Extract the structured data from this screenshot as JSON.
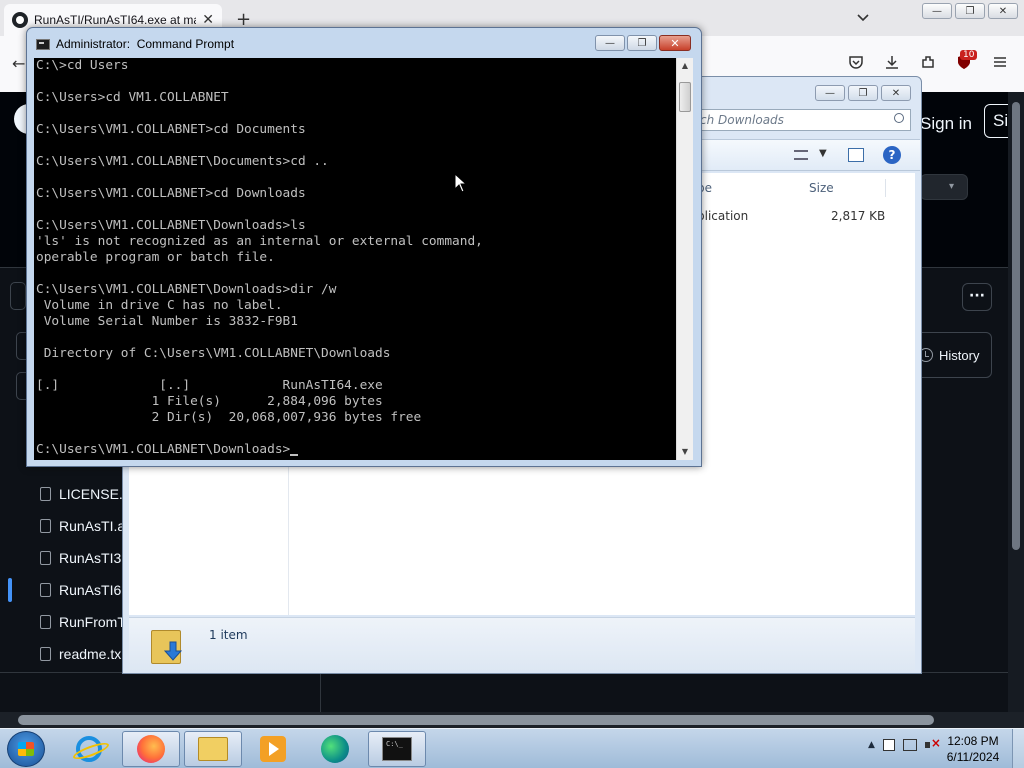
{
  "browser": {
    "tab_title": "RunAsTI/RunAsTI64.exe at ma",
    "tab_close": "✕",
    "new_tab": "+",
    "badge_count": "10",
    "win_min": "—",
    "win_restore": "❐",
    "win_close": "✕"
  },
  "github": {
    "sign_in": "Sign in",
    "sign_up": "Si",
    "more": "···",
    "history_label": "History",
    "files": [
      {
        "name": "LICENSE.r"
      },
      {
        "name": "RunAsTI.a"
      },
      {
        "name": "RunAsTI3"
      },
      {
        "name": "RunAsTI6"
      },
      {
        "name": "RunFromT"
      },
      {
        "name": "readme.tx"
      }
    ]
  },
  "explorer": {
    "search_placeholder": "ch Downloads",
    "columns": [
      "pe",
      "Size"
    ],
    "rows": [
      {
        "type": "plication",
        "size": "2,817 KB"
      }
    ],
    "status": "1 item"
  },
  "cmd": {
    "title": "Administrator:  Command Prompt",
    "lines": [
      "C:\\>cd Users",
      "",
      "C:\\Users>cd VM1.COLLABNET",
      "",
      "C:\\Users\\VM1.COLLABNET>cd Documents",
      "",
      "C:\\Users\\VM1.COLLABNET\\Documents>cd ..",
      "",
      "C:\\Users\\VM1.COLLABNET>cd Downloads",
      "",
      "C:\\Users\\VM1.COLLABNET\\Downloads>ls",
      "'ls' is not recognized as an internal or external command,",
      "operable program or batch file.",
      "",
      "C:\\Users\\VM1.COLLABNET\\Downloads>dir /w",
      " Volume in drive C has no label.",
      " Volume Serial Number is 3832-F9B1",
      "",
      " Directory of C:\\Users\\VM1.COLLABNET\\Downloads",
      "",
      "[.]             [..]            RunAsTI64.exe",
      "               1 File(s)      2,884,096 bytes",
      "               2 Dir(s)  20,068,007,936 bytes free",
      ""
    ],
    "prompt": "C:\\Users\\VM1.COLLABNET\\Downloads>"
  },
  "taskbar": {
    "time": "12:08 PM",
    "date": "6/11/2024",
    "apps": [
      "internet-explorer",
      "firefox",
      "windows-explorer",
      "media-player",
      "edge",
      "command-prompt"
    ]
  }
}
